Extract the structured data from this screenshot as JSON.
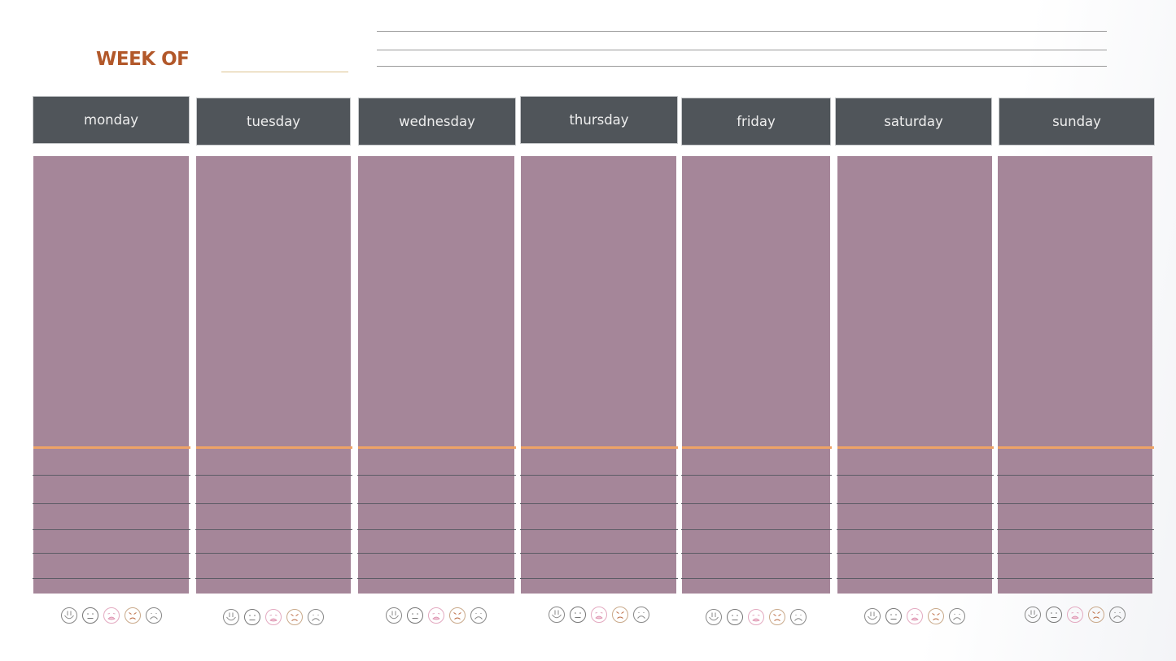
{
  "header": {
    "title": "WEEK OF",
    "week_of_value": "",
    "notes_lines": 3
  },
  "colors": {
    "title": "#b2582a",
    "header_bg": "#50555a",
    "column_bg": "#a58699",
    "accent_line": "#eea366",
    "row_line": "#5c5c66"
  },
  "days": [
    {
      "label": "monday"
    },
    {
      "label": "tuesday"
    },
    {
      "label": "wednesday"
    },
    {
      "label": "thursday"
    },
    {
      "label": "friday"
    },
    {
      "label": "saturday"
    },
    {
      "label": "sunday"
    }
  ],
  "moods": [
    "happy-face",
    "neutral-face",
    "crying-face",
    "angry-face",
    "sad-face"
  ],
  "rows_per_day": 5
}
